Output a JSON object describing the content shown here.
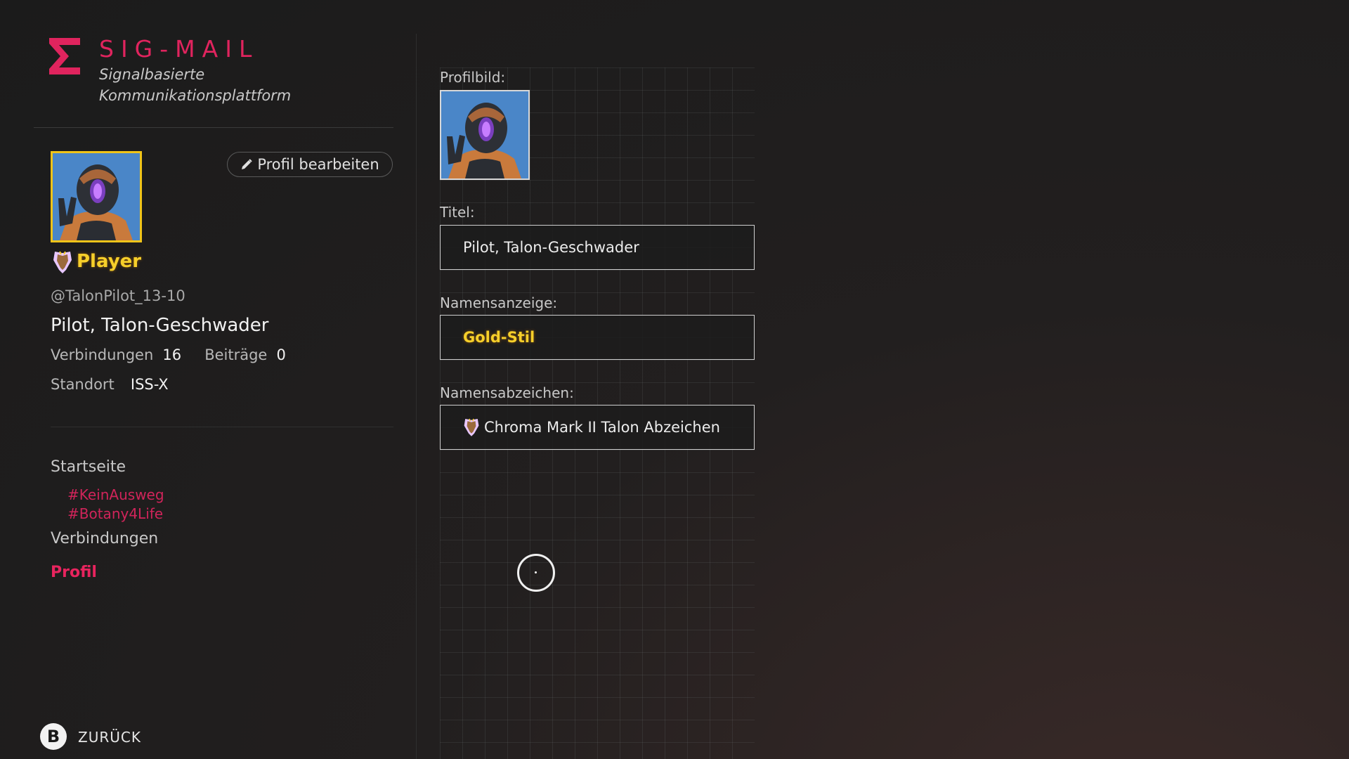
{
  "app": {
    "title": "SIG-MAIL",
    "subtitle": "Signalbasierte Kommunikationsplattform",
    "accent_color": "#e0245e"
  },
  "profile": {
    "edit_button_label": "Profil bearbeiten",
    "display_name": "Player",
    "handle": "@TalonPilot_13-10",
    "title": "Pilot, Talon-Geschwader",
    "connections_label": "Verbindungen",
    "connections_value": "16",
    "posts_label": "Beiträge",
    "posts_value": "0",
    "location_label": "Standort",
    "location_value": "ISS-X",
    "name_color": "#f6cf2a"
  },
  "nav": {
    "home": "Startseite",
    "tags": [
      "#KeinAusweg",
      "#Botany4Life"
    ],
    "connections": "Verbindungen",
    "profile": "Profil"
  },
  "form": {
    "picture_label": "Profilbild:",
    "title_label": "Titel:",
    "title_value": "Pilot, Talon-Geschwader",
    "name_display_label": "Namensanzeige:",
    "name_display_value": "Gold-Stil",
    "badge_label": "Namensabzeichen:",
    "badge_value": "Chroma Mark II Talon Abzeichen"
  },
  "footer": {
    "back_button_glyph": "B",
    "back_label": "ZURÜCK"
  },
  "icons": {
    "logo": "sigma-logo-icon",
    "edit": "pencil-icon",
    "badge": "talon-wings-badge-icon",
    "cursor": "cursor-ring-icon"
  }
}
